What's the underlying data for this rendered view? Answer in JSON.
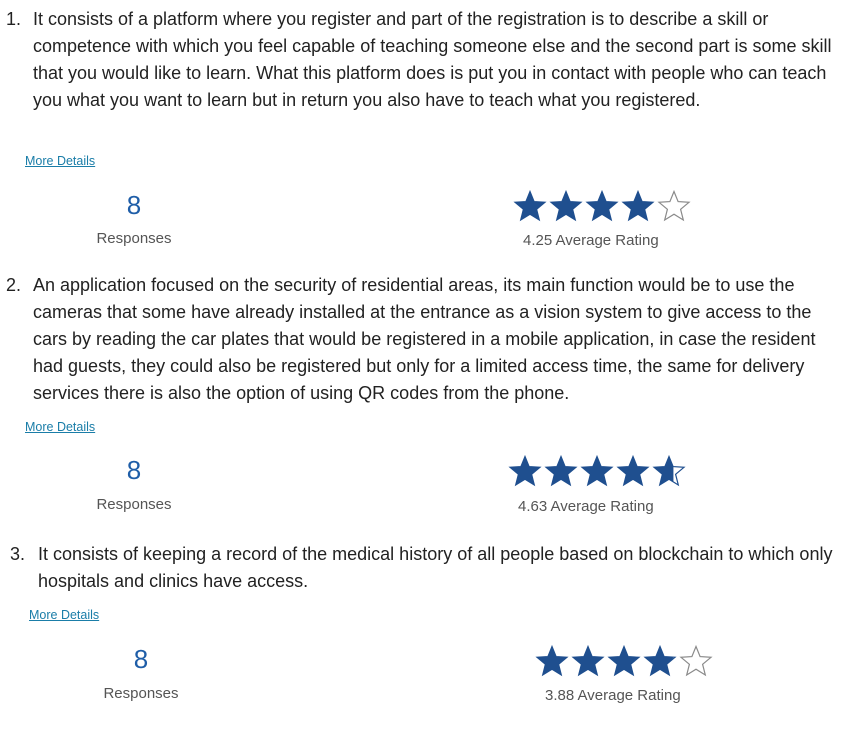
{
  "colors": {
    "star_fill": "#1f4f8f",
    "star_empty_stroke": "#8a8a8a",
    "count": "#1f5ea8",
    "link": "#1a7da8"
  },
  "questions": [
    {
      "number": "1.",
      "text": "It consists of a platform where you register and part of the registration is to describe a skill or competence with which you feel capable of teaching someone else and the second part is some skill that you would like to learn. What this platform does is put you in contact with people who can teach you what you want to learn but in return you also have to teach what you registered.",
      "more_details": "More Details",
      "count": "8",
      "count_label": "Responses",
      "rating_value": 4.25,
      "rating_label": "4.25 Average Rating"
    },
    {
      "number": "2.",
      "text": "An application focused on the security of residential areas, its main function would be to use the cameras that some have already installed at the entrance as a vision system to give access to the cars by reading the car plates that would be registered in a mobile application, in case the resident had guests, they could also be registered but only for a limited access time, the same for delivery services there is also the option of using QR codes from the phone.",
      "more_details": "More Details",
      "count": "8",
      "count_label": "Responses",
      "rating_value": 4.63,
      "rating_label": "4.63 Average Rating"
    },
    {
      "number": "3.",
      "text": "It consists of keeping a record of the medical history of all people based on blockchain to which only hospitals and clinics have access.",
      "more_details": "More Details",
      "count": "8",
      "count_label": "Responses",
      "rating_value": 3.88,
      "rating_label": "3.88 Average Rating"
    }
  ]
}
